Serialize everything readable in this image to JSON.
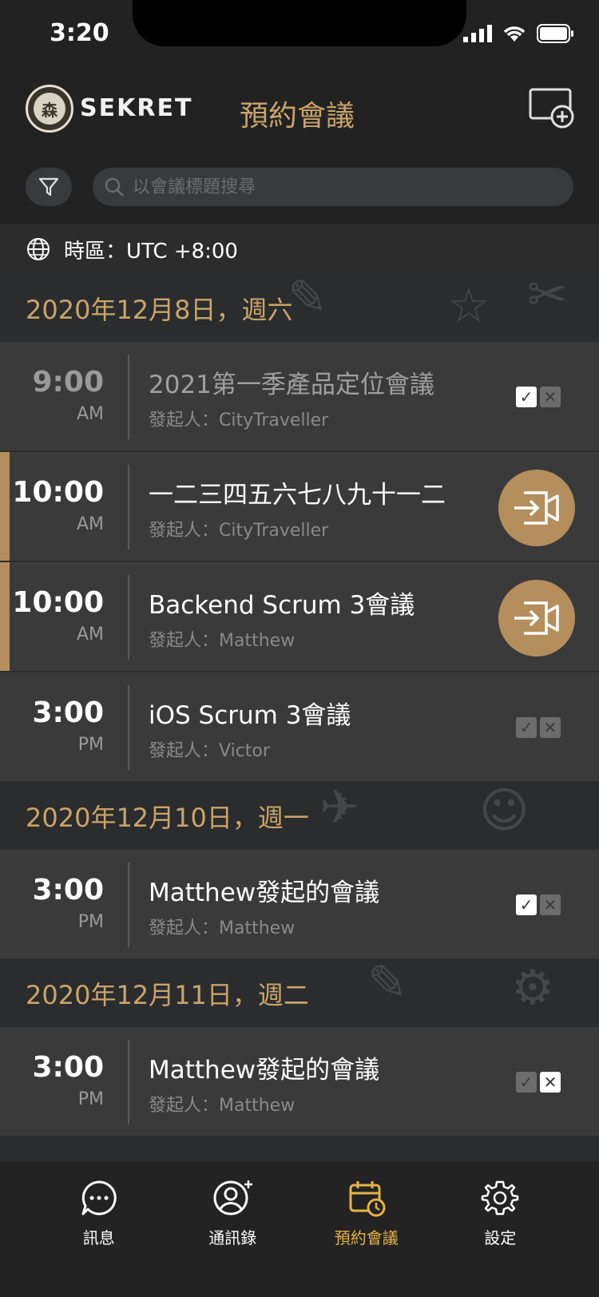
{
  "status_bar": {
    "time": "3:20"
  },
  "header": {
    "brand": "SEKRET",
    "logo_char": "森",
    "title": "預約會議"
  },
  "search": {
    "placeholder": "以會議標題搜尋"
  },
  "timezone": {
    "label": "時區：UTC +8:00"
  },
  "groups": [
    {
      "date": "2020年12月8日，週六",
      "meetings": [
        {
          "time": "9:00",
          "ampm": "AM",
          "title": "2021第一季產品定位會議",
          "host": "發起人：CityTraveller",
          "state": "past"
        },
        {
          "time": "10:00",
          "ampm": "AM",
          "title": "一二三四五六七八九十一二",
          "host": "發起人：CityTraveller",
          "state": "live"
        },
        {
          "time": "10:00",
          "ampm": "AM",
          "title": "Backend Scrum 3會議",
          "host": "發起人：Matthew",
          "state": "live"
        },
        {
          "time": "3:00",
          "ampm": "PM",
          "title": "iOS Scrum 3會議",
          "host": "發起人：Victor",
          "state": "none"
        }
      ]
    },
    {
      "date": "2020年12月10日，週一",
      "meetings": [
        {
          "time": "3:00",
          "ampm": "PM",
          "title": "Matthew發起的會議",
          "host": "發起人：Matthew",
          "state": "accepted"
        }
      ]
    },
    {
      "date": "2020年12月11日，週二",
      "meetings": [
        {
          "time": "3:00",
          "ampm": "PM",
          "title": "Matthew發起的會議",
          "host": "發起人：Matthew",
          "state": "declined"
        }
      ]
    }
  ],
  "tabs": [
    {
      "label": "訊息",
      "icon": "chat-bubble-icon"
    },
    {
      "label": "通訊錄",
      "icon": "contacts-icon"
    },
    {
      "label": "預約會議",
      "icon": "calendar-clock-icon",
      "active": true
    },
    {
      "label": "設定",
      "icon": "gear-icon"
    }
  ],
  "colors": {
    "accent_gold": "#c9a46a",
    "active_tab": "#e5b347",
    "row_bg": "#3a3a3a"
  }
}
